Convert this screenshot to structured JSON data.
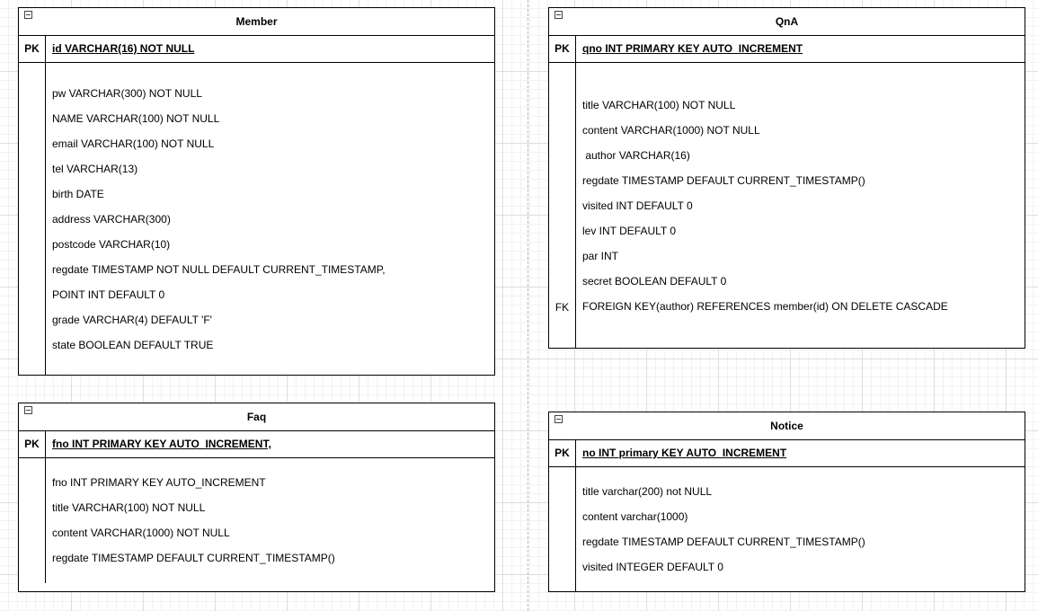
{
  "tables": {
    "member": {
      "title": "Member",
      "pk_label": "PK",
      "pk_field": "id VARCHAR(16) NOT NULL",
      "fields": [
        "pw VARCHAR(300) NOT NULL",
        "NAME VARCHAR(100) NOT NULL",
        "email VARCHAR(100) NOT NULL",
        "tel VARCHAR(13)",
        "birth DATE",
        "address VARCHAR(300)",
        "postcode VARCHAR(10)",
        "regdate TIMESTAMP NOT NULL DEFAULT CURRENT_TIMESTAMP,",
        "POINT INT DEFAULT 0",
        "grade VARCHAR(4) DEFAULT 'F'",
        "state BOOLEAN DEFAULT TRUE"
      ]
    },
    "qna": {
      "title": "QnA",
      "pk_label": "PK",
      "pk_field": "qno INT PRIMARY KEY AUTO_INCREMENT",
      "fields": [
        "title VARCHAR(100) NOT NULL",
        "content VARCHAR(1000) NOT NULL",
        " author VARCHAR(16)",
        "regdate TIMESTAMP DEFAULT CURRENT_TIMESTAMP()",
        "visited INT DEFAULT 0",
        "lev INT DEFAULT 0",
        "par INT",
        "secret BOOLEAN DEFAULT 0",
        "FOREIGN KEY(author) REFERENCES member(id) ON DELETE CASCADE"
      ],
      "fk_label": "FK"
    },
    "faq": {
      "title": "Faq",
      "pk_label": "PK",
      "pk_field": "fno INT PRIMARY KEY AUTO_INCREMENT,",
      "fields": [
        "fno INT PRIMARY KEY AUTO_INCREMENT",
        "title VARCHAR(100) NOT NULL",
        "content VARCHAR(1000) NOT NULL",
        "regdate TIMESTAMP DEFAULT CURRENT_TIMESTAMP()"
      ]
    },
    "notice": {
      "title": "Notice",
      "pk_label": "PK",
      "pk_field": "no INT primary KEY AUTO_INCREMENT",
      "fields": [
        "title varchar(200) not NULL",
        "content varchar(1000)",
        "regdate TIMESTAMP DEFAULT CURRENT_TIMESTAMP()",
        "visited INTEGER DEFAULT 0"
      ]
    }
  }
}
